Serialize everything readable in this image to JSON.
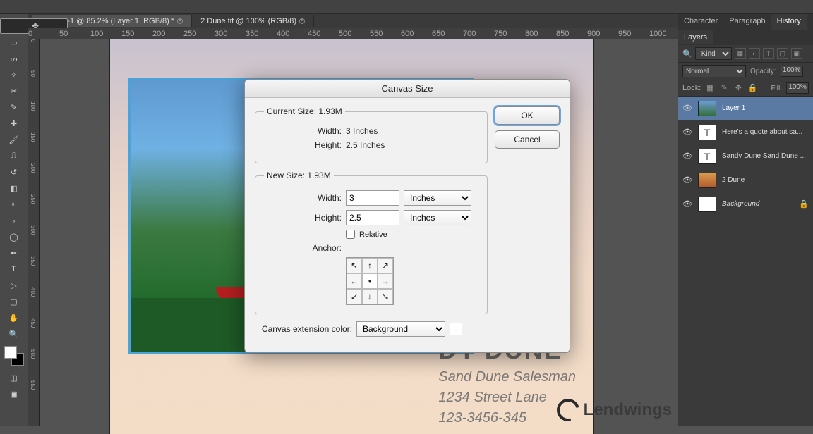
{
  "tabs": {
    "t1": "Untitled-1 @ 85.2% (Layer 1, RGB/8) *",
    "t2": "2 Dune.tif @ 100% (RGB/8)"
  },
  "ruler_h": [
    "0",
    "50",
    "100",
    "150",
    "200",
    "250",
    "300",
    "350",
    "400",
    "450",
    "500",
    "550",
    "600",
    "650",
    "700",
    "750",
    "800",
    "850",
    "900",
    "950",
    "1000"
  ],
  "ruler_v": [
    "0",
    "50",
    "100",
    "150",
    "200",
    "250",
    "300",
    "350",
    "400",
    "450",
    "500",
    "550"
  ],
  "panels": {
    "tab_character": "Character",
    "tab_paragraph": "Paragraph",
    "tab_history": "History",
    "tab_layers": "Layers",
    "kind": "Kind",
    "blend": "Normal",
    "opacity_label": "Opacity:",
    "opacity_val": "100%",
    "lock_label": "Lock:",
    "fill_label": "Fill:",
    "fill_val": "100%",
    "layers": {
      "l1": "Layer 1",
      "l2": "Here's a quote about sa...",
      "l3": "Sandy Dune Sand Dune ...",
      "l4": "2 Dune",
      "l5": "Background"
    }
  },
  "card": {
    "h1": "DY DUNE",
    "p1": "Sand Dune Salesman",
    "p2": "1234 Street Lane",
    "p3": "123-3456-345"
  },
  "dialog": {
    "title": "Canvas Size",
    "ok": "OK",
    "cancel": "Cancel",
    "legend_cur": "Current Size: 1.93M",
    "cur_w_label": "Width:",
    "cur_w_val": "3 Inches",
    "cur_h_label": "Height:",
    "cur_h_val": "2.5 Inches",
    "legend_new": "New Size: 1.93M",
    "width_label": "Width:",
    "width_val": "3",
    "height_label": "Height:",
    "height_val": "2.5",
    "unit": "Inches",
    "relative": "Relative",
    "anchor_label": "Anchor:",
    "ext_label": "Canvas extension color:",
    "ext_val": "Background"
  },
  "watermark": "Lendwings"
}
